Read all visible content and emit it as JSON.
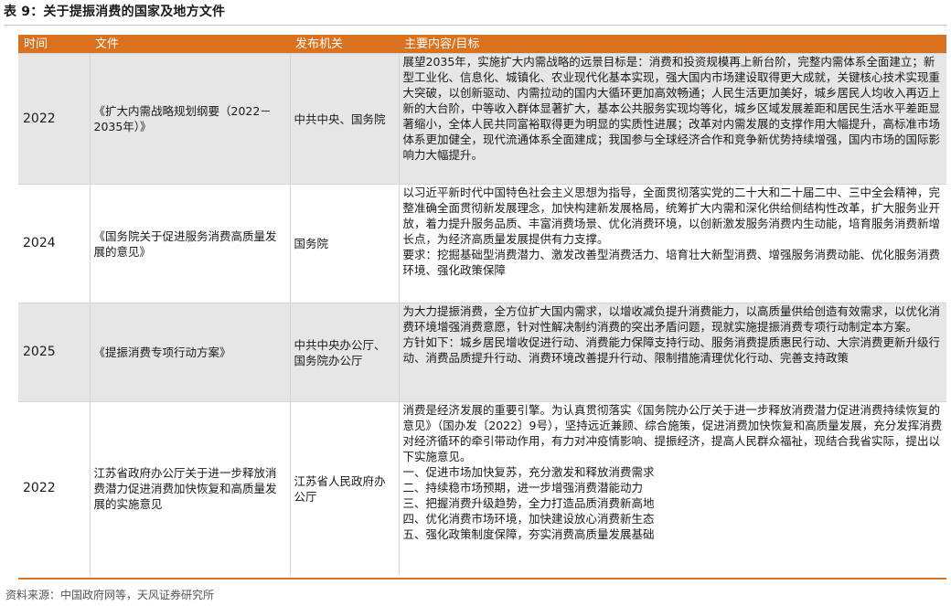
{
  "title": "表 9：关于提振消费的国家及地方文件",
  "columns": [
    "时间",
    "文件",
    "发布机关",
    "主要内容/目标"
  ],
  "rows": [
    {
      "year": "2022",
      "doc": "《扩大内需战略规划纲要（2022－2035年）》",
      "org": "中共中央、国务院",
      "content": [
        "展望2035年，实施扩大内需战略的远景目标是：消费和投资规模再上新台阶，完整内需体系全面建立；新型工业化、信息化、城镇化、农业现代化基本实现，强大国内市场建设取得更大成就，关键核心技术实现重大突破，以创新驱动、内需拉动的国内大循环更加高效畅通；人民生活更加美好，城乡居民人均收入再迈上新的大台阶，中等收入群体显著扩大，基本公共服务实现均等化，城乡区域发展差距和居民生活水平差距显著缩小，全体人民共同富裕取得更为明显的实质性进展；改革对内需发展的支撑作用大幅提升，高标准市场体系更加健全，现代流通体系全面建成；我国参与全球经济合作和竞争新优势持续增强，国内市场的国际影响力大幅提升。"
      ]
    },
    {
      "year": "2024",
      "doc": "《国务院关于促进服务消费高质量发展的意见》",
      "org": "国务院",
      "content": [
        "以习近平新时代中国特色社会主义思想为指导，全面贯彻落实党的二十大和二十届二中、三中全会精神，完整准确全面贯彻新发展理念，加快构建新发展格局，统筹扩大内需和深化供给侧结构性改革，扩大服务业开放，着力提升服务品质、丰富消费场景、优化消费环境，以创新激发服务消费内生动能，培育服务消费新增长点，为经济高质量发展提供有力支撑。",
        "要求：挖掘基础型消费潜力、激发改善型消费活力、培育壮大新型消费、增强服务消费动能、优化服务消费环境、强化政策保障"
      ]
    },
    {
      "year": "2025",
      "doc": "《提振消费专项行动方案》",
      "org": "中共中央办公厅、国务院办公厅",
      "content": [
        "为大力提振消费，全方位扩大国内需求，以增收减负提升消费能力，以高质量供给创造有效需求，以优化消费环境增强消费意愿，针对性解决制约消费的突出矛盾问题，现就实施提振消费专项行动制定本方案。",
        "方针如下：城乡居民增收促进行动、消费能力保障支持行动、服务消费提质惠民行动、大宗消费更新升级行动、消费品质提升行动、消费环境改善提升行动、限制措施清理优化行动、完善支持政策"
      ]
    },
    {
      "year": "2022",
      "doc": "江苏省政府办公厅关于进一步释放消费潜力促进消费加快恢复和高质量发展的实施意见",
      "org": "江苏省人民政府办公厅",
      "content": [
        "消费是经济发展的重要引擎。为认真贯彻落实《国务院办公厅关于进一步释放消费潜力促进消费持续恢复的意见》（国办发〔2022〕9号），坚持远近兼顾、综合施策，促进消费加快恢复和高质量发展，充分发挥消费对经济循环的牵引带动作用，有力对冲疫情影响、提振经济，提高人民群众福祉，现结合我省实际，提出以下实施意见。",
        "一、促进市场加快复苏，充分激发和释放消费需求",
        "二、持续稳市场预期，进一步增强消费潜能动力",
        "三、把握消费升级趋势，全力打造品质消费新高地",
        "四、优化消费市场环境，加快建设放心消费新生态",
        "五、强化政策制度保障，夯实消费高质量发展基础"
      ]
    }
  ],
  "source": "资料来源：中国政府网等，天风证券研究所"
}
